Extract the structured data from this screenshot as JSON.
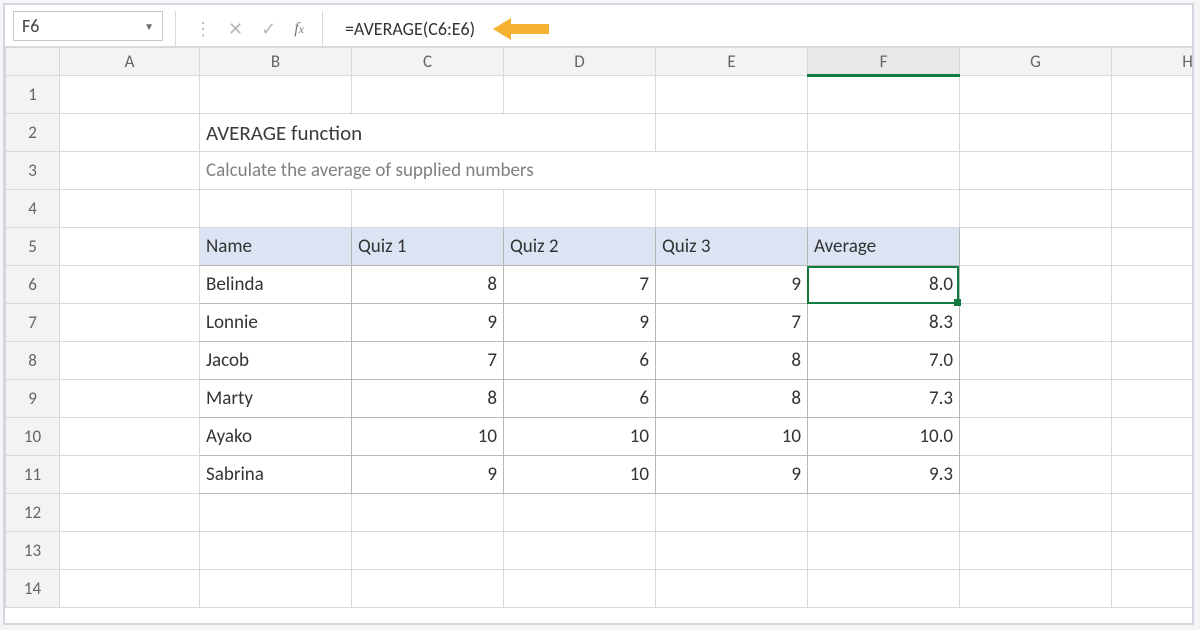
{
  "namebox": {
    "value": "F6"
  },
  "formula_bar": {
    "formula": "=AVERAGE(C6:E6)"
  },
  "columns": [
    "A",
    "B",
    "C",
    "D",
    "E",
    "F",
    "G",
    "H"
  ],
  "rows": [
    "1",
    "2",
    "3",
    "4",
    "5",
    "6",
    "7",
    "8",
    "9",
    "10",
    "11",
    "12",
    "13",
    "14"
  ],
  "selected_column": "F",
  "selected_cell": "F6",
  "colors": {
    "accent": "#107c41",
    "arrow": "#f4b132",
    "header_fill": "#dbe4f3"
  },
  "content": {
    "title": "AVERAGE function",
    "subtitle": "Calculate the average of supplied numbers",
    "table": {
      "headers": [
        "Name",
        "Quiz 1",
        "Quiz 2",
        "Quiz 3",
        "Average"
      ],
      "rows": [
        {
          "name": "Belinda",
          "q1": "8",
          "q2": "7",
          "q3": "9",
          "avg": "8.0"
        },
        {
          "name": "Lonnie",
          "q1": "9",
          "q2": "9",
          "q3": "7",
          "avg": "8.3"
        },
        {
          "name": "Jacob",
          "q1": "7",
          "q2": "6",
          "q3": "8",
          "avg": "7.0"
        },
        {
          "name": "Marty",
          "q1": "8",
          "q2": "6",
          "q3": "8",
          "avg": "7.3"
        },
        {
          "name": "Ayako",
          "q1": "10",
          "q2": "10",
          "q3": "10",
          "avg": "10.0"
        },
        {
          "name": "Sabrina",
          "q1": "9",
          "q2": "10",
          "q3": "9",
          "avg": "9.3"
        }
      ]
    }
  }
}
